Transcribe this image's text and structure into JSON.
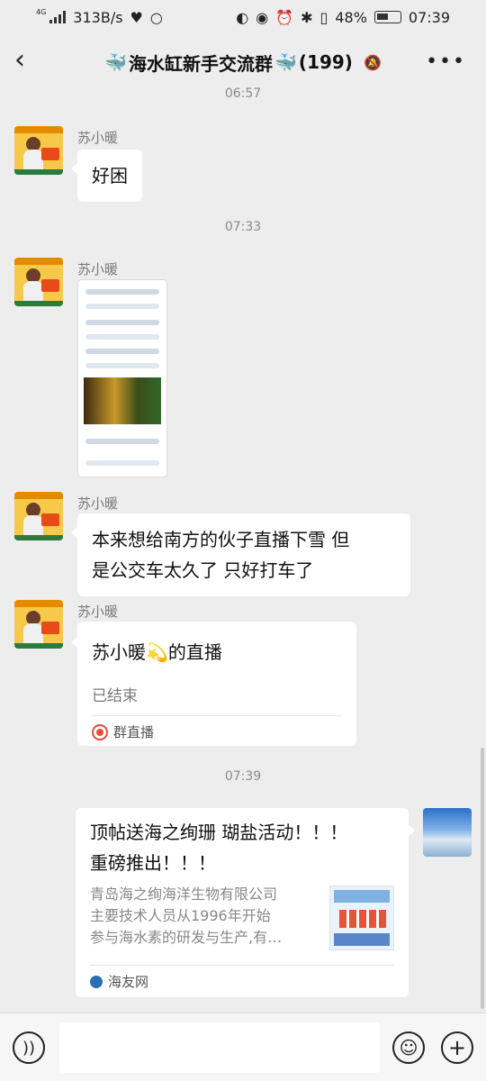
{
  "status_bar": {
    "network": "4G",
    "speed": "313B/s",
    "battery": "48%",
    "time": "07:39"
  },
  "header": {
    "title": "海水缸新手交流群",
    "member_count": "(199)"
  },
  "messages": [
    {
      "time": "06:57"
    },
    {
      "sender": "苏小暖",
      "text": "好困"
    },
    {
      "time": "07:33"
    },
    {
      "sender": "苏小暖",
      "type": "image"
    },
    {
      "sender": "苏小暖",
      "text_line1": "本来想给南方的伙子直播下雪 但",
      "text_line2": "是公交车太久了 只好打车了"
    },
    {
      "sender": "苏小暖",
      "live_title": "苏小暖",
      "live_title_suffix": "的直播",
      "live_status": "已结束",
      "live_source": "群直播"
    },
    {
      "time": "07:39"
    },
    {
      "type": "link",
      "title_line1": "顶帖送海之绚珊 瑚盐活动！！！",
      "title_line2": "重磅推出！！！",
      "desc_line1": "青岛海之绚海洋生物有限公司",
      "desc_line2": "主要技术人员从1996年开始",
      "desc_line3": "参与海水素的研发与生产,有…",
      "source": "海友网"
    }
  ]
}
